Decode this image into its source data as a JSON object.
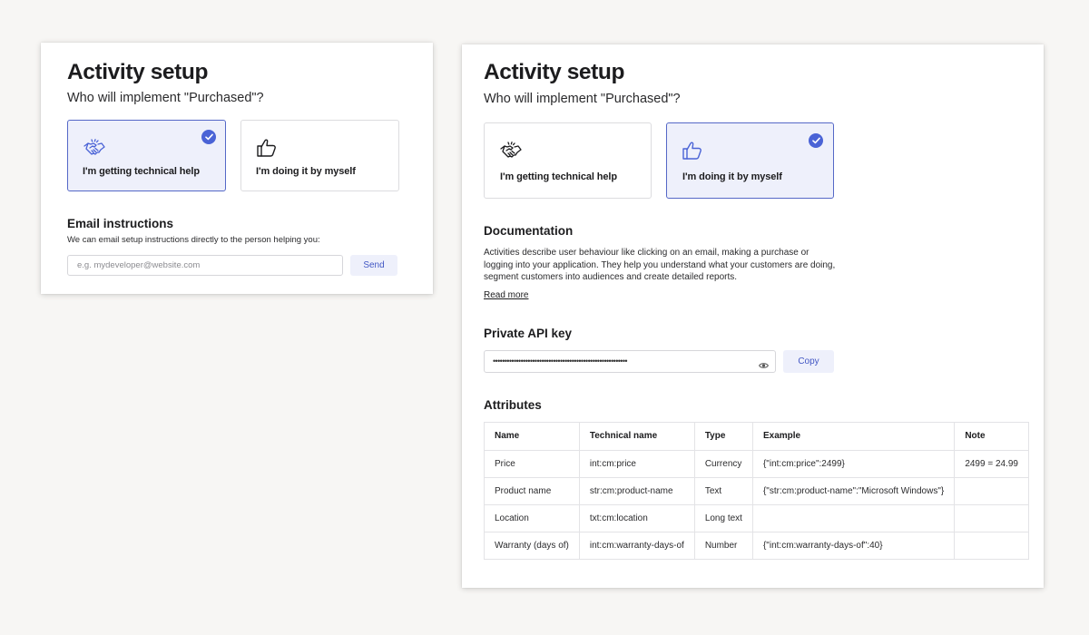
{
  "left": {
    "title": "Activity setup",
    "subtitle": "Who will implement \"Purchased\"?",
    "options": [
      {
        "label": "I'm getting technical help",
        "icon": "handshake-icon",
        "selected": true
      },
      {
        "label": "I'm doing it by myself",
        "icon": "thumbs-up-icon",
        "selected": false
      }
    ],
    "email_title": "Email instructions",
    "email_desc": "We can email setup instructions directly to the person helping you:",
    "email_placeholder": "e.g. mydeveloper@website.com",
    "send_label": "Send"
  },
  "right": {
    "title": "Activity setup",
    "subtitle": "Who will implement \"Purchased\"?",
    "options": [
      {
        "label": "I'm getting technical help",
        "icon": "handshake-icon",
        "selected": false
      },
      {
        "label": "I'm doing it by myself",
        "icon": "thumbs-up-icon",
        "selected": true
      }
    ],
    "doc_title": "Documentation",
    "doc_text": "Activities describe user behaviour like clicking on an email, making a purchase or logging into your application. They help you understand what your customers are doing, segment customers into audiences and create detailed reports.",
    "read_more": "Read more",
    "api_title": "Private API key",
    "api_key_masked": "••••••••••••••••••••••••••••••••••••••••••••••••••••••••••",
    "copy_label": "Copy",
    "attr_title": "Attributes",
    "table": {
      "headers": [
        "Name",
        "Technical name",
        "Type",
        "Example",
        "Note"
      ],
      "rows": [
        [
          "Price",
          "int:cm:price",
          "Currency",
          "{\"int:cm:price\":2499}",
          "2499 = 24.99"
        ],
        [
          "Product name",
          "str:cm:product-name",
          "Text",
          "{\"str:cm:product-name\":\"Microsoft Windows\"}",
          ""
        ],
        [
          "Location",
          "txt:cm:location",
          "Long text",
          "",
          ""
        ],
        [
          "Warranty (days of)",
          "int:cm:warranty-days-of",
          "Number",
          "{\"int:cm:warranty-days-of\":40}",
          ""
        ]
      ]
    }
  },
  "colors": {
    "accent": "#4a63d6",
    "selected_bg": "#eef0fb",
    "selected_border": "#5568c7",
    "page_bg": "#f7f6f4"
  }
}
